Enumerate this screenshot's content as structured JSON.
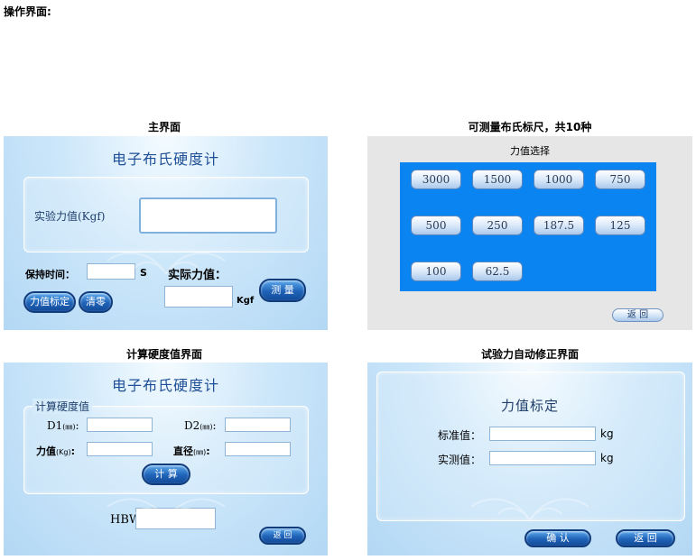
{
  "page_title": "操作界面:",
  "captions": {
    "main": "主界面",
    "ruler": "可测量布氏标尺，共10种",
    "calc": "计算硬度值界面",
    "calib": "试验力自动修正界面"
  },
  "main_panel": {
    "title": "电子布氏硬度计",
    "test_force_label": "实验力值(Kgf)",
    "hold_time_label": "保持时间：",
    "hold_time_unit": "S",
    "actual_force_label": "实际力值：",
    "actual_force_unit": "Kgf",
    "btn_calibrate": "力值标定",
    "btn_clear": "清零",
    "btn_measure": "测 量"
  },
  "ruler_panel": {
    "heading": "力值选择",
    "options": [
      "3000",
      "1500",
      "1000",
      "750",
      "500",
      "250",
      "187.5",
      "125",
      "100",
      "62.5"
    ],
    "btn_back": "返 回"
  },
  "calc_panel": {
    "title": "电子布氏硬度计",
    "group_label": "计算硬度值",
    "d1_label": "D1",
    "d2_label": "D2",
    "mm_unit": "(㎜)",
    "force_label": "力值",
    "kg_unit": "(Kg)",
    "diameter_label": "直径",
    "btn_calc": "计 算",
    "hbw_label": "HBW",
    "btn_back": "返 回"
  },
  "calib_panel": {
    "title": "力值标定",
    "std_label": "标准值：",
    "std_unit": "kg",
    "meas_label": "实测值：",
    "meas_unit": "kg",
    "btn_confirm": "确 认",
    "btn_back": "返 回"
  },
  "colors": {
    "panel_blue": "#cde7fa",
    "force_area": "#0a84f0",
    "button_dark": "#1f63b8",
    "title_text": "#1f4f96"
  }
}
